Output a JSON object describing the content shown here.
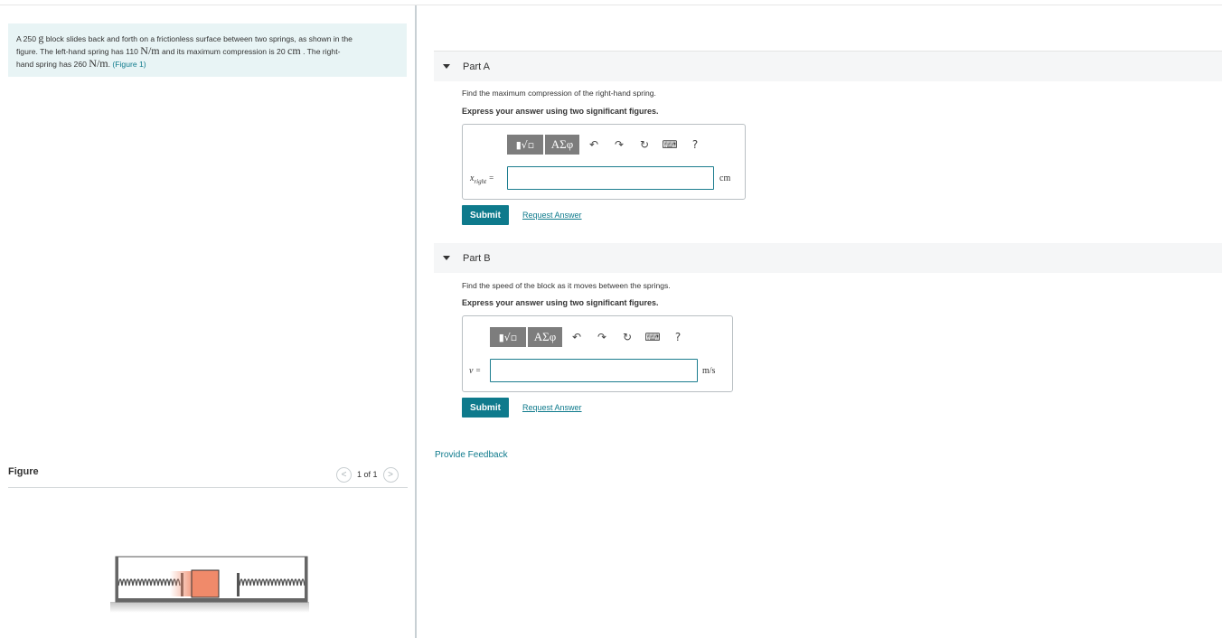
{
  "problem": {
    "line1_pre": "A 250",
    "line1_unit": "g",
    "line1_post": "block slides back and forth on a frictionless surface between two springs, as shown in the",
    "line2_pre": "figure. The left-hand spring has 110",
    "line2_unit": "N/m",
    "line2_mid": "and its maximum compression is 20",
    "line2_unit2": "cm",
    "line2_post": ". The right-",
    "line3_pre": "hand spring has 260",
    "line3_unit": "N/m",
    "line3_post": ".",
    "figure_link": "(Figure 1)"
  },
  "figure": {
    "title": "Figure",
    "pager": "1 of 1",
    "prev_glyph": "<",
    "next_glyph": ">",
    "block_color": "#f08a6a"
  },
  "part_a": {
    "label": "Part A",
    "question": "Find the maximum compression of the right-hand spring.",
    "instruction": "Express your answer using two significant figures.",
    "var_main": "x",
    "var_sub": "right",
    "eq": "=",
    "unit": "cm",
    "submit": "Submit",
    "request": "Request Answer"
  },
  "part_b": {
    "label": "Part B",
    "question": "Find the speed of the block as it moves between the springs.",
    "instruction": "Express your answer using two significant figures.",
    "var_main": "v",
    "eq": "=",
    "unit": "m/s",
    "submit": "Submit",
    "request": "Request Answer"
  },
  "toolbar": {
    "template_glyph": "▮√▫",
    "greek_glyph": "ΑΣφ",
    "undo_glyph": "↶",
    "redo_glyph": "↷",
    "reset_glyph": "↻",
    "keyboard_glyph": "⌨",
    "help_glyph": "?"
  },
  "feedback": "Provide Feedback",
  "colors": {
    "accent": "#0e7a8c",
    "problem_bg": "#e8f4f5"
  }
}
